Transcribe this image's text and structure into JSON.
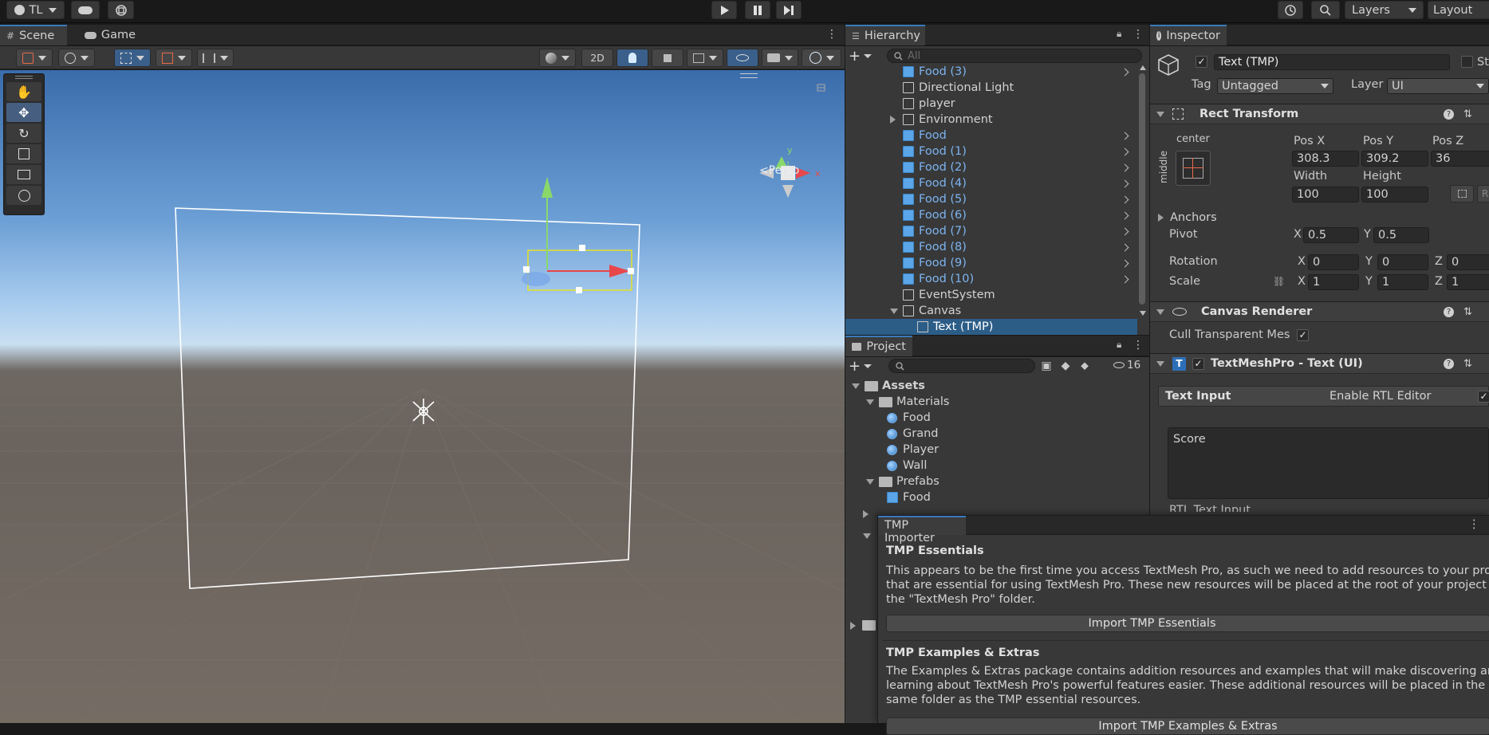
{
  "topbar": {
    "account": "TL",
    "layers_label": "Layers",
    "layout_label": "Layout"
  },
  "scene": {
    "tabs": [
      "Scene",
      "Game"
    ],
    "toggle_2d": "2D",
    "persp_label": "<Persp",
    "gizmo_y": "y",
    "gizmo_x": "x"
  },
  "hierarchy": {
    "title": "Hierarchy",
    "search_placeholder": "All",
    "items": [
      {
        "label": "Food (3)",
        "prefab": true,
        "indent": 1,
        "expander": false,
        "chevron": true
      },
      {
        "label": "Directional Light",
        "prefab": false,
        "indent": 1,
        "expander": false,
        "chevron": false
      },
      {
        "label": "player",
        "prefab": false,
        "indent": 1,
        "expander": false,
        "chevron": false
      },
      {
        "label": "Environment",
        "prefab": false,
        "indent": 1,
        "expander": "right",
        "chevron": false
      },
      {
        "label": "Food",
        "prefab": true,
        "indent": 1,
        "expander": false,
        "chevron": true
      },
      {
        "label": "Food (1)",
        "prefab": true,
        "indent": 1,
        "expander": false,
        "chevron": true
      },
      {
        "label": "Food (2)",
        "prefab": true,
        "indent": 1,
        "expander": false,
        "chevron": true
      },
      {
        "label": "Food (4)",
        "prefab": true,
        "indent": 1,
        "expander": false,
        "chevron": true
      },
      {
        "label": "Food (5)",
        "prefab": true,
        "indent": 1,
        "expander": false,
        "chevron": true
      },
      {
        "label": "Food (6)",
        "prefab": true,
        "indent": 1,
        "expander": false,
        "chevron": true
      },
      {
        "label": "Food (7)",
        "prefab": true,
        "indent": 1,
        "expander": false,
        "chevron": true
      },
      {
        "label": "Food (8)",
        "prefab": true,
        "indent": 1,
        "expander": false,
        "chevron": true
      },
      {
        "label": "Food (9)",
        "prefab": true,
        "indent": 1,
        "expander": false,
        "chevron": true
      },
      {
        "label": "Food (10)",
        "prefab": true,
        "indent": 1,
        "expander": false,
        "chevron": true
      },
      {
        "label": "EventSystem",
        "prefab": false,
        "indent": 1,
        "expander": false,
        "chevron": false
      },
      {
        "label": "Canvas",
        "prefab": false,
        "indent": 1,
        "expander": "down",
        "chevron": false
      },
      {
        "label": "Text (TMP)",
        "prefab": false,
        "indent": 2,
        "expander": false,
        "chevron": false,
        "selected": true
      }
    ]
  },
  "project": {
    "title": "Project",
    "hidden_count": "16",
    "tree": [
      {
        "label": "Assets",
        "type": "folder",
        "indent": 0,
        "bold": true
      },
      {
        "label": "Materials",
        "type": "folder",
        "indent": 1
      },
      {
        "label": "Food",
        "type": "material",
        "indent": 2
      },
      {
        "label": "Grand",
        "type": "material",
        "indent": 2
      },
      {
        "label": "Player",
        "type": "material",
        "indent": 2
      },
      {
        "label": "Wall",
        "type": "material",
        "indent": 2
      },
      {
        "label": "Prefabs",
        "type": "folder",
        "indent": 1
      },
      {
        "label": "Food",
        "type": "prefab",
        "indent": 2
      }
    ]
  },
  "inspector": {
    "title": "Inspector",
    "object_name": "Text (TMP)",
    "static_label": "Static",
    "tag_label": "Tag",
    "tag_value": "Untagged",
    "layer_label": "Layer",
    "layer_value": "UI",
    "rect_transform": {
      "title": "Rect Transform",
      "anchor_h": "center",
      "anchor_v": "middle",
      "pos_x_label": "Pos X",
      "pos_x": "308.3",
      "pos_y_label": "Pos Y",
      "pos_y": "309.2",
      "pos_z_label": "Pos Z",
      "pos_z": "36",
      "width_label": "Width",
      "width": "100",
      "height_label": "Height",
      "height": "100",
      "raw_label": "R",
      "anchors_label": "Anchors",
      "pivot_label": "Pivot",
      "pivot_x": "0.5",
      "pivot_y": "0.5",
      "rotation_label": "Rotation",
      "rot_x": "0",
      "rot_y": "0",
      "rot_z": "0",
      "scale_label": "Scale",
      "scale_x": "1",
      "scale_y": "1",
      "scale_z": "1",
      "x": "X",
      "y": "Y",
      "z": "Z"
    },
    "canvas_renderer": {
      "title": "Canvas Renderer",
      "cull_label": "Cull Transparent Mes"
    },
    "textmeshpro": {
      "title": "TextMeshPro - Text (UI)",
      "text_input_label": "Text Input",
      "rtl_label": "Enable RTL Editor",
      "text_value": "Score",
      "rtl_input_label": "RTL Text Input"
    }
  },
  "tmp_importer": {
    "title": "TMP Importer",
    "essentials_heading": "TMP Essentials",
    "essentials_text_1": "This appears to be the first time you access TextMesh Pro, as such we need to add resources to your proje",
    "essentials_text_2": "that are essential for using TextMesh Pro. These new resources will be placed at the root of your project i",
    "essentials_text_3": "the \"TextMesh Pro\" folder.",
    "essentials_button": "Import TMP Essentials",
    "extras_heading": "TMP Examples & Extras",
    "extras_text_1": "The Examples & Extras package contains addition resources and examples that will make discovering and",
    "extras_text_2": "learning about TextMesh Pro's powerful features easier. These additional resources will be placed in the",
    "extras_text_3": "same folder as the TMP essential resources.",
    "extras_button": "Import TMP Examples & Extras"
  }
}
